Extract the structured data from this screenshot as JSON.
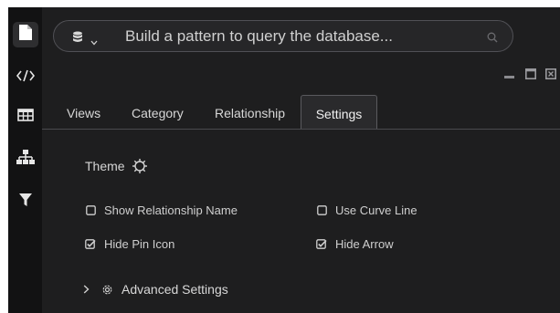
{
  "search": {
    "placeholder": "Build a pattern to query the database..."
  },
  "sidebar": {
    "items": [
      {
        "name": "document-icon",
        "active": true
      },
      {
        "name": "code-icon",
        "active": false
      },
      {
        "name": "table-icon",
        "active": false
      },
      {
        "name": "hierarchy-icon",
        "active": false
      },
      {
        "name": "filter-icon",
        "active": false
      }
    ]
  },
  "window_controls": [
    "minimize-icon",
    "maximize-icon",
    "close-icon"
  ],
  "tabs": [
    {
      "label": "Views",
      "active": false
    },
    {
      "label": "Category",
      "active": false
    },
    {
      "label": "Relationship",
      "active": false
    },
    {
      "label": "Settings",
      "active": true
    }
  ],
  "settings": {
    "theme_label": "Theme",
    "options": [
      {
        "label": "Show Relationship Name",
        "checked": false
      },
      {
        "label": "Use Curve Line",
        "checked": false
      },
      {
        "label": "Hide Pin Icon",
        "checked": true
      },
      {
        "label": "Hide Arrow",
        "checked": true
      }
    ],
    "advanced_label": "Advanced Settings"
  },
  "colors": {
    "background": "#1e1e1f",
    "rail": "#121213",
    "text": "#d7d7d7",
    "border": "#505055"
  }
}
